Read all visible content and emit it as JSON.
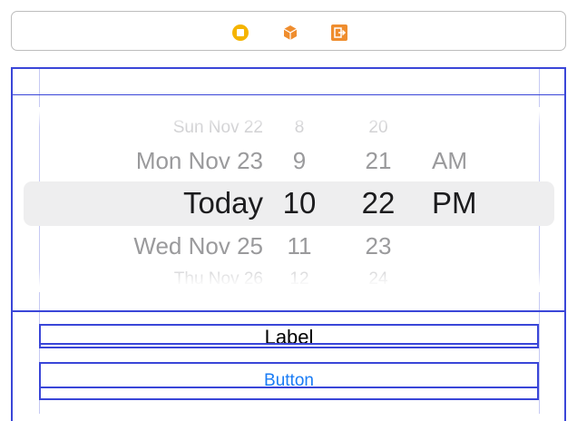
{
  "scene_dock": {
    "icons": [
      "view-controller-icon",
      "first-responder-icon",
      "exit-icon"
    ],
    "colors": {
      "view_controller": "#f5b400",
      "first_responder": "#ef8d2e",
      "exit": "#ef8d2e"
    }
  },
  "date_picker": {
    "rows": [
      {
        "day": "Sun Nov 22",
        "hour": "8",
        "minute": "20",
        "ampm": ""
      },
      {
        "day": "Mon Nov 23",
        "hour": "9",
        "minute": "21",
        "ampm": "AM"
      },
      {
        "day": "Today",
        "hour": "10",
        "minute": "22",
        "ampm": "PM"
      },
      {
        "day": "Wed Nov 25",
        "hour": "11",
        "minute": "23",
        "ampm": ""
      },
      {
        "day": "Thu Nov 26",
        "hour": "12",
        "minute": "24",
        "ampm": ""
      }
    ]
  },
  "label": {
    "text": "Label"
  },
  "button": {
    "text": "Button"
  },
  "colors": {
    "outline": "#3a46d8",
    "button_tint": "#1a7cf5"
  }
}
